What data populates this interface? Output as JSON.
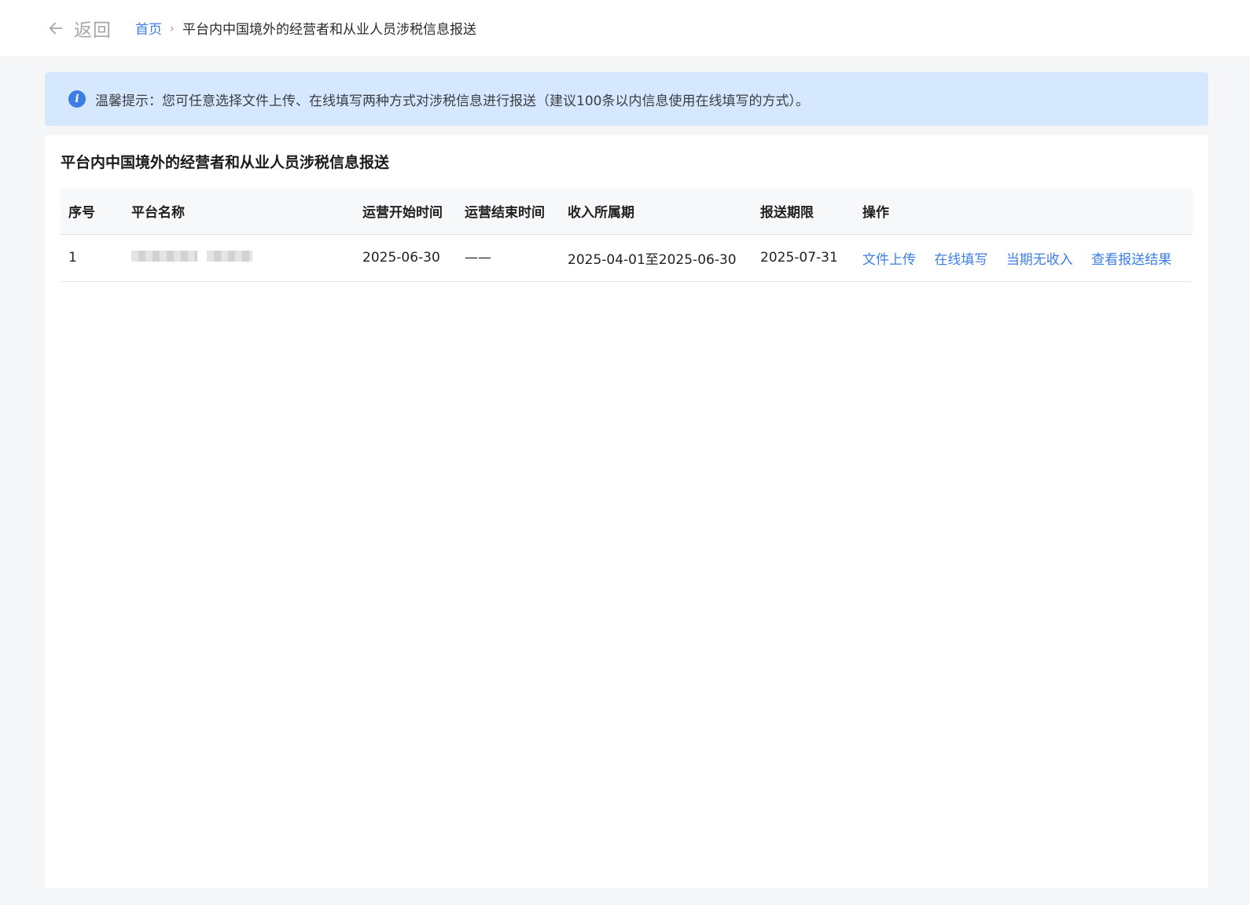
{
  "header": {
    "back_label": "返回",
    "breadcrumb": {
      "home": "首页",
      "separator": "›",
      "current": "平台内中国境外的经营者和从业人员涉税信息报送"
    }
  },
  "tip": {
    "icon": "info-icon",
    "text": "温馨提示：您可任意选择文件上传、在线填写两种方式对涉税信息进行报送（建议100条以内信息使用在线填写的方式）。"
  },
  "panel": {
    "title": "平台内中国境外的经营者和从业人员涉税信息报送"
  },
  "table": {
    "columns": [
      "序号",
      "平台名称",
      "运营开始时间",
      "运营结束时间",
      "收入所属期",
      "报送期限",
      "操作"
    ],
    "rows": [
      {
        "index": "1",
        "platform_name": "",
        "start": "2025-06-30",
        "end": "——",
        "period": "2025-04-01至2025-06-30",
        "deadline": "2025-07-31",
        "actions": [
          "文件上传",
          "在线填写",
          "当期无收入",
          "查看报送结果"
        ]
      }
    ]
  },
  "colors": {
    "accent": "#3c7ee6",
    "tip_background": "#d6e8fd",
    "page_background": "#f5f6f8"
  }
}
